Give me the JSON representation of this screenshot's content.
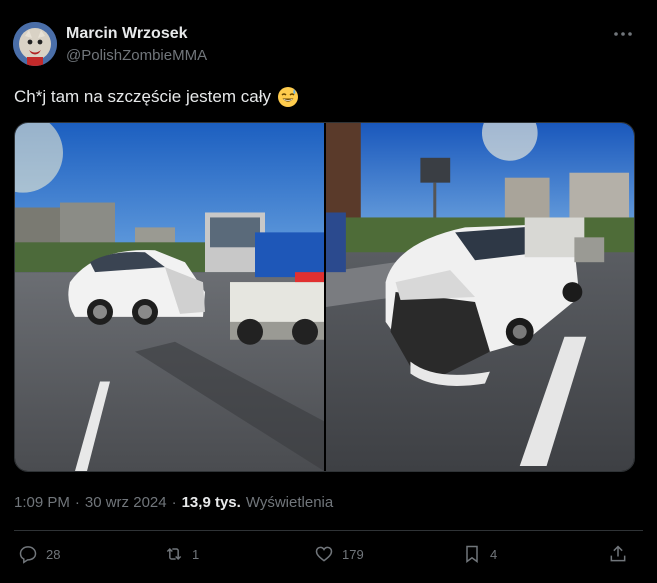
{
  "author": {
    "display_name": "Marcin Wrzosek",
    "handle": "@PolishZombieMMA"
  },
  "tweet": {
    "text": "Ch*j tam na szczęście jestem cały",
    "emoji": "sweat-smile-emoji"
  },
  "media": [
    {
      "description": "white BMW with crashed front against a tow truck"
    },
    {
      "description": "white BMW with destroyed front bumper on road"
    }
  ],
  "meta": {
    "time": "1:09 PM",
    "sep1": "·",
    "date": "30 wrz 2024",
    "sep2": "·",
    "views_count": "13,9 tys.",
    "views_label": "Wyświetlenia"
  },
  "actions": {
    "replies": "28",
    "reposts": "1",
    "likes": "179",
    "bookmarks": "4"
  },
  "colors": {
    "background": "#000000",
    "text": "#e7e9ea",
    "muted": "#71767b",
    "border": "#2f3336"
  }
}
